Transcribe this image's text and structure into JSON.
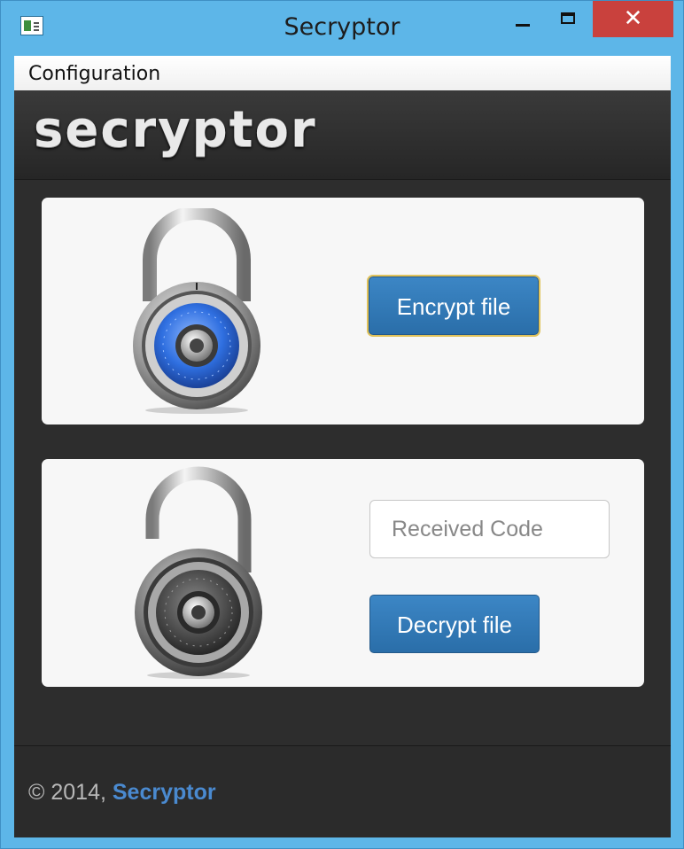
{
  "window": {
    "title": "Secryptor",
    "close_glyph": "✕",
    "app_icon": "app-window-icon"
  },
  "menu": {
    "items": [
      {
        "label": "Configuration"
      }
    ]
  },
  "header": {
    "logo_text": "secryptor"
  },
  "encrypt": {
    "button_label": "Encrypt file",
    "lock_icon": "closed-padlock-icon",
    "lock_accent": "#2f6fe0"
  },
  "decrypt": {
    "code_placeholder": "Received Code",
    "code_value": "",
    "button_label": "Decrypt file",
    "lock_icon": "open-padlock-icon"
  },
  "footer": {
    "copyright": "© 2014, ",
    "brand": "Secryptor",
    "brand_color": "#4a8ad0"
  },
  "colors": {
    "frame": "#5db6e8",
    "close_button": "#c9413d",
    "button_blue": "#2f78b8",
    "dark_bg": "#2d2d2d"
  }
}
